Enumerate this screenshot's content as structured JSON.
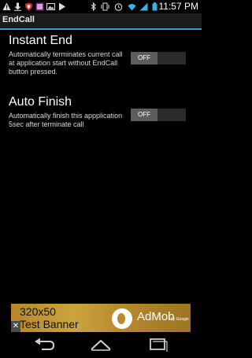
{
  "status_bar": {
    "time": "11:57 PM",
    "icons": [
      "warning-icon",
      "download-icon",
      "shield-icon",
      "gallery-icon",
      "photo-icon",
      "play-icon",
      "bluetooth-icon",
      "vibrate-icon",
      "alarm-icon",
      "wifi-icon",
      "signal-icon",
      "battery-icon"
    ]
  },
  "title_bar": {
    "title": "EndCall"
  },
  "settings": [
    {
      "title": "Instant End",
      "description": "Automatically terminates current call at application start without EndCall button pressed.",
      "toggle_label": "OFF",
      "enabled": false
    },
    {
      "title": "Auto Finish",
      "description": "Automatically finish this appplication 5sec after terminate call",
      "toggle_label": "OFF",
      "enabled": false
    }
  ],
  "ad_banner": {
    "size_text": "320x50",
    "label_text": "Test Banner",
    "brand": "AdMob",
    "by_text": "by Google",
    "close_symbol": "✕"
  },
  "nav_bar": {
    "buttons": [
      "back-icon",
      "home-icon",
      "recent-apps-icon"
    ]
  },
  "colors": {
    "accent": "#2fa3d3",
    "background": "#000000",
    "toggle_track": "#2b2b2b",
    "toggle_thumb": "#5d5d5d"
  }
}
